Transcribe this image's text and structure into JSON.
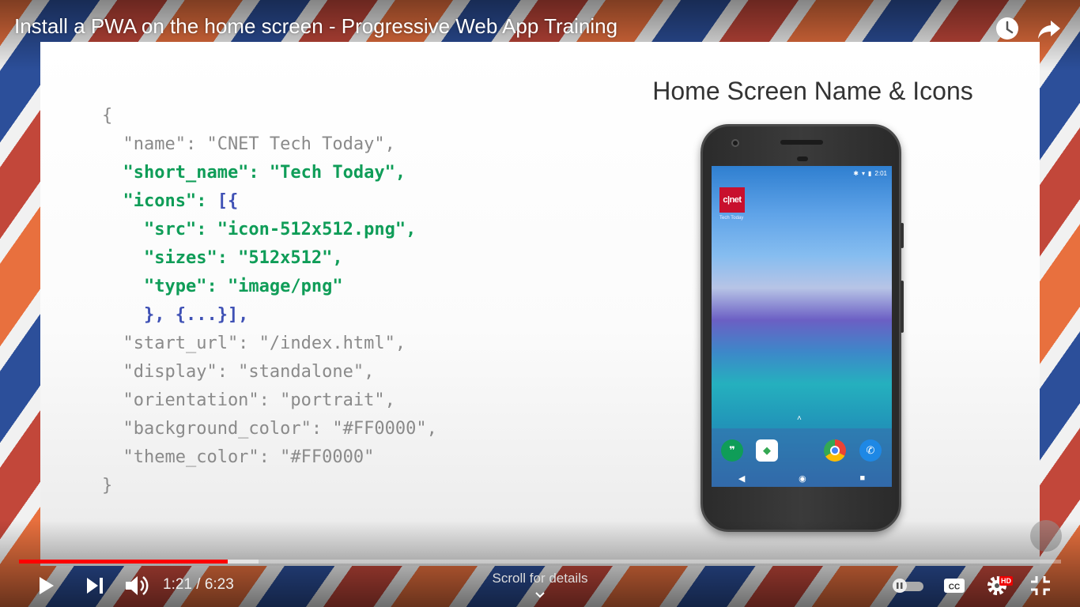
{
  "video": {
    "title": "Install a PWA on the home screen - Progressive Web App Training",
    "time_current": "1:21",
    "time_separator": " / ",
    "time_total": "6:23",
    "progress_played_fraction": 0.2,
    "progress_loaded_fraction": 0.23,
    "scroll_hint": "Scroll for details",
    "quality_badge": "HD"
  },
  "slide": {
    "heading": "Home Screen Name & Icons",
    "code_lines": [
      [
        {
          "t": "{",
          "c": ""
        }
      ],
      [
        {
          "t": "  \"name\": \"CNET Tech Today\",",
          "c": ""
        }
      ],
      [
        {
          "t": "  \"short_name\": \"Tech Today\"",
          "c": "hl"
        },
        {
          "t": ",",
          "c": "hl"
        }
      ],
      [
        {
          "t": "  \"icons\": ",
          "c": "hl"
        },
        {
          "t": "[{",
          "c": "br"
        }
      ],
      [
        {
          "t": "    \"src\": \"icon-512x512.png\",",
          "c": "hl"
        }
      ],
      [
        {
          "t": "    \"sizes\": \"512x512\",",
          "c": "hl"
        }
      ],
      [
        {
          "t": "    \"type\": \"image/png\"",
          "c": "hl"
        }
      ],
      [
        {
          "t": "    }, {...}],",
          "c": "br"
        }
      ],
      [
        {
          "t": "  \"start_url\": \"/index.html\",",
          "c": ""
        }
      ],
      [
        {
          "t": "  \"display\": \"standalone\",",
          "c": ""
        }
      ],
      [
        {
          "t": "  \"orientation\": \"portrait\",",
          "c": ""
        }
      ],
      [
        {
          "t": "  \"background_color\": \"#FF0000\",",
          "c": ""
        }
      ],
      [
        {
          "t": "  \"theme_color\": \"#FF0000\"",
          "c": ""
        }
      ],
      [
        {
          "t": "}",
          "c": ""
        }
      ]
    ],
    "phone": {
      "status_time": "2:01",
      "app_icon_text": "c|net",
      "app_label": "Tech Today"
    }
  },
  "colors": {
    "progress_red": "#ff0000",
    "code_highlight": "#0f9d58",
    "code_bracket": "#3f51b5",
    "code_default": "#8a8a8a",
    "cnet_red": "#c8102e"
  },
  "icons": [
    "watch-later-icon",
    "share-icon",
    "play-icon",
    "next-icon",
    "volume-icon",
    "autoplay-toggle-icon",
    "captions-icon",
    "settings-icon",
    "exit-fullscreen-icon",
    "chevron-down-icon"
  ]
}
